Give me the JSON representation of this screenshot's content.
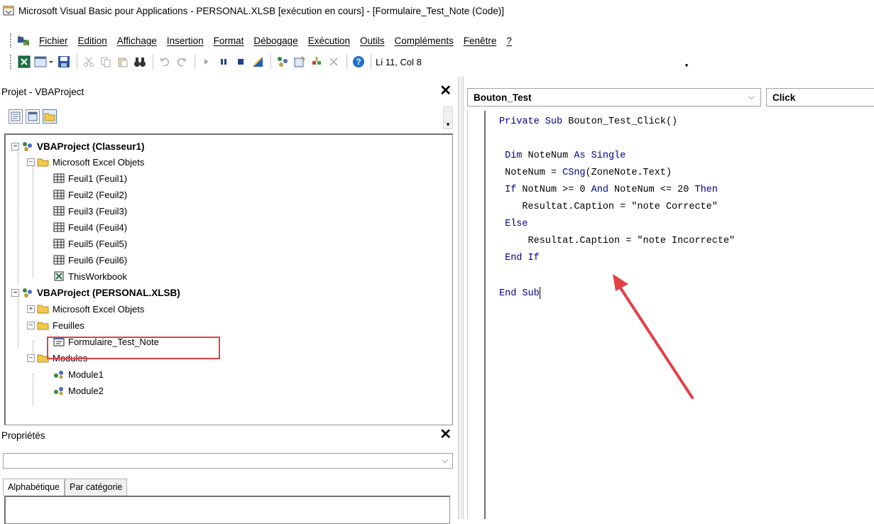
{
  "window": {
    "title": "Microsoft Visual Basic pour Applications - PERSONAL.XLSB [exécution en cours] - [Formulaire_Test_Note (Code)]",
    "app_icon": "vba-app-icon"
  },
  "menubar": {
    "items": [
      "Fichier",
      "Edition",
      "Affichage",
      "Insertion",
      "Format",
      "Débogage",
      "Exécution",
      "Outils",
      "Compléments",
      "Fenêtre",
      "?"
    ]
  },
  "toolbar": {
    "position": "Li 11, Col 8"
  },
  "project_pane": {
    "title": "Projet - VBAProject",
    "tree": [
      "VBAProject (Classeur1)",
      "Microsoft Excel Objets",
      "Feuil1 (Feuil1)",
      "Feuil2 (Feuil2)",
      "Feuil3 (Feuil3)",
      "Feuil4 (Feuil4)",
      "Feuil5 (Feuil5)",
      "Feuil6 (Feuil6)",
      "ThisWorkbook",
      "VBAProject (PERSONAL.XLSB)",
      "Microsoft Excel Objets",
      "Feuilles",
      "Formulaire_Test_Note",
      "Modules",
      "Module1",
      "Module2"
    ]
  },
  "properties_pane": {
    "title": "Propriétés",
    "tabs": [
      "Alphabétique",
      "Par catégorie"
    ]
  },
  "code_window": {
    "object_combo": "Bouton_Test",
    "procedure_combo": "Click",
    "lines": [
      "Private Sub Bouton_Test_Click()",
      "",
      " Dim NoteNum As Single",
      " NoteNum = CSng(ZoneNote.Text)",
      " If NotNum >= 0 And NoteNum <= 20 Then",
      "    Resultat.Caption = \"note Correcte\"",
      " Else",
      "     Resultat.Caption = \"note Incorrecte\"",
      " End If",
      "",
      "End Sub"
    ]
  },
  "colors": {
    "keyword": "#00008b",
    "highlight": "#e04248"
  }
}
